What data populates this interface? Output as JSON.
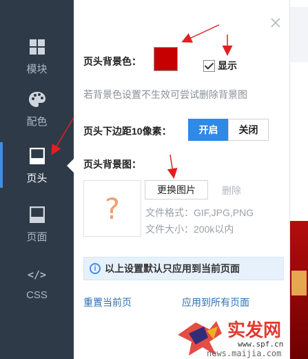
{
  "sidebar": {
    "items": [
      {
        "label": "模块",
        "icon": "grid-icon"
      },
      {
        "label": "配色",
        "icon": "palette-icon"
      },
      {
        "label": "页头",
        "icon": "header-icon",
        "active": true
      },
      {
        "label": "页面",
        "icon": "page-icon"
      },
      {
        "label": "CSS",
        "icon": "code-icon"
      }
    ],
    "css_glyph": "</>"
  },
  "panel": {
    "bg_color_label": "页头背景色：",
    "bg_color_value": "#c60000",
    "show_label": "显示",
    "show_checked": true,
    "hint": "若背景色设置不生效可尝试删除背景图",
    "margin_label": "页头下边距10像素：",
    "toggle_on": "开启",
    "toggle_off": "关闭",
    "bg_image_label": "页头背景图：",
    "placeholder_glyph": "?",
    "change_image": "更换图片",
    "delete": "删除",
    "file_format": "文件格式：GIF,JPG,PNG",
    "file_size": "文件大小：200k以内",
    "notice": "以上设置默认只应用到当前页面",
    "reset_link": "重置当前页",
    "apply_all_link": "应用到所有页面"
  },
  "watermark": {
    "brand": "实发网",
    "url": "www.spf.cn",
    "url2": "news.maijia.com"
  },
  "colors": {
    "sidebar_bg": "#2e3a48",
    "accent": "#2f89e6",
    "arrow": "#e02020"
  }
}
